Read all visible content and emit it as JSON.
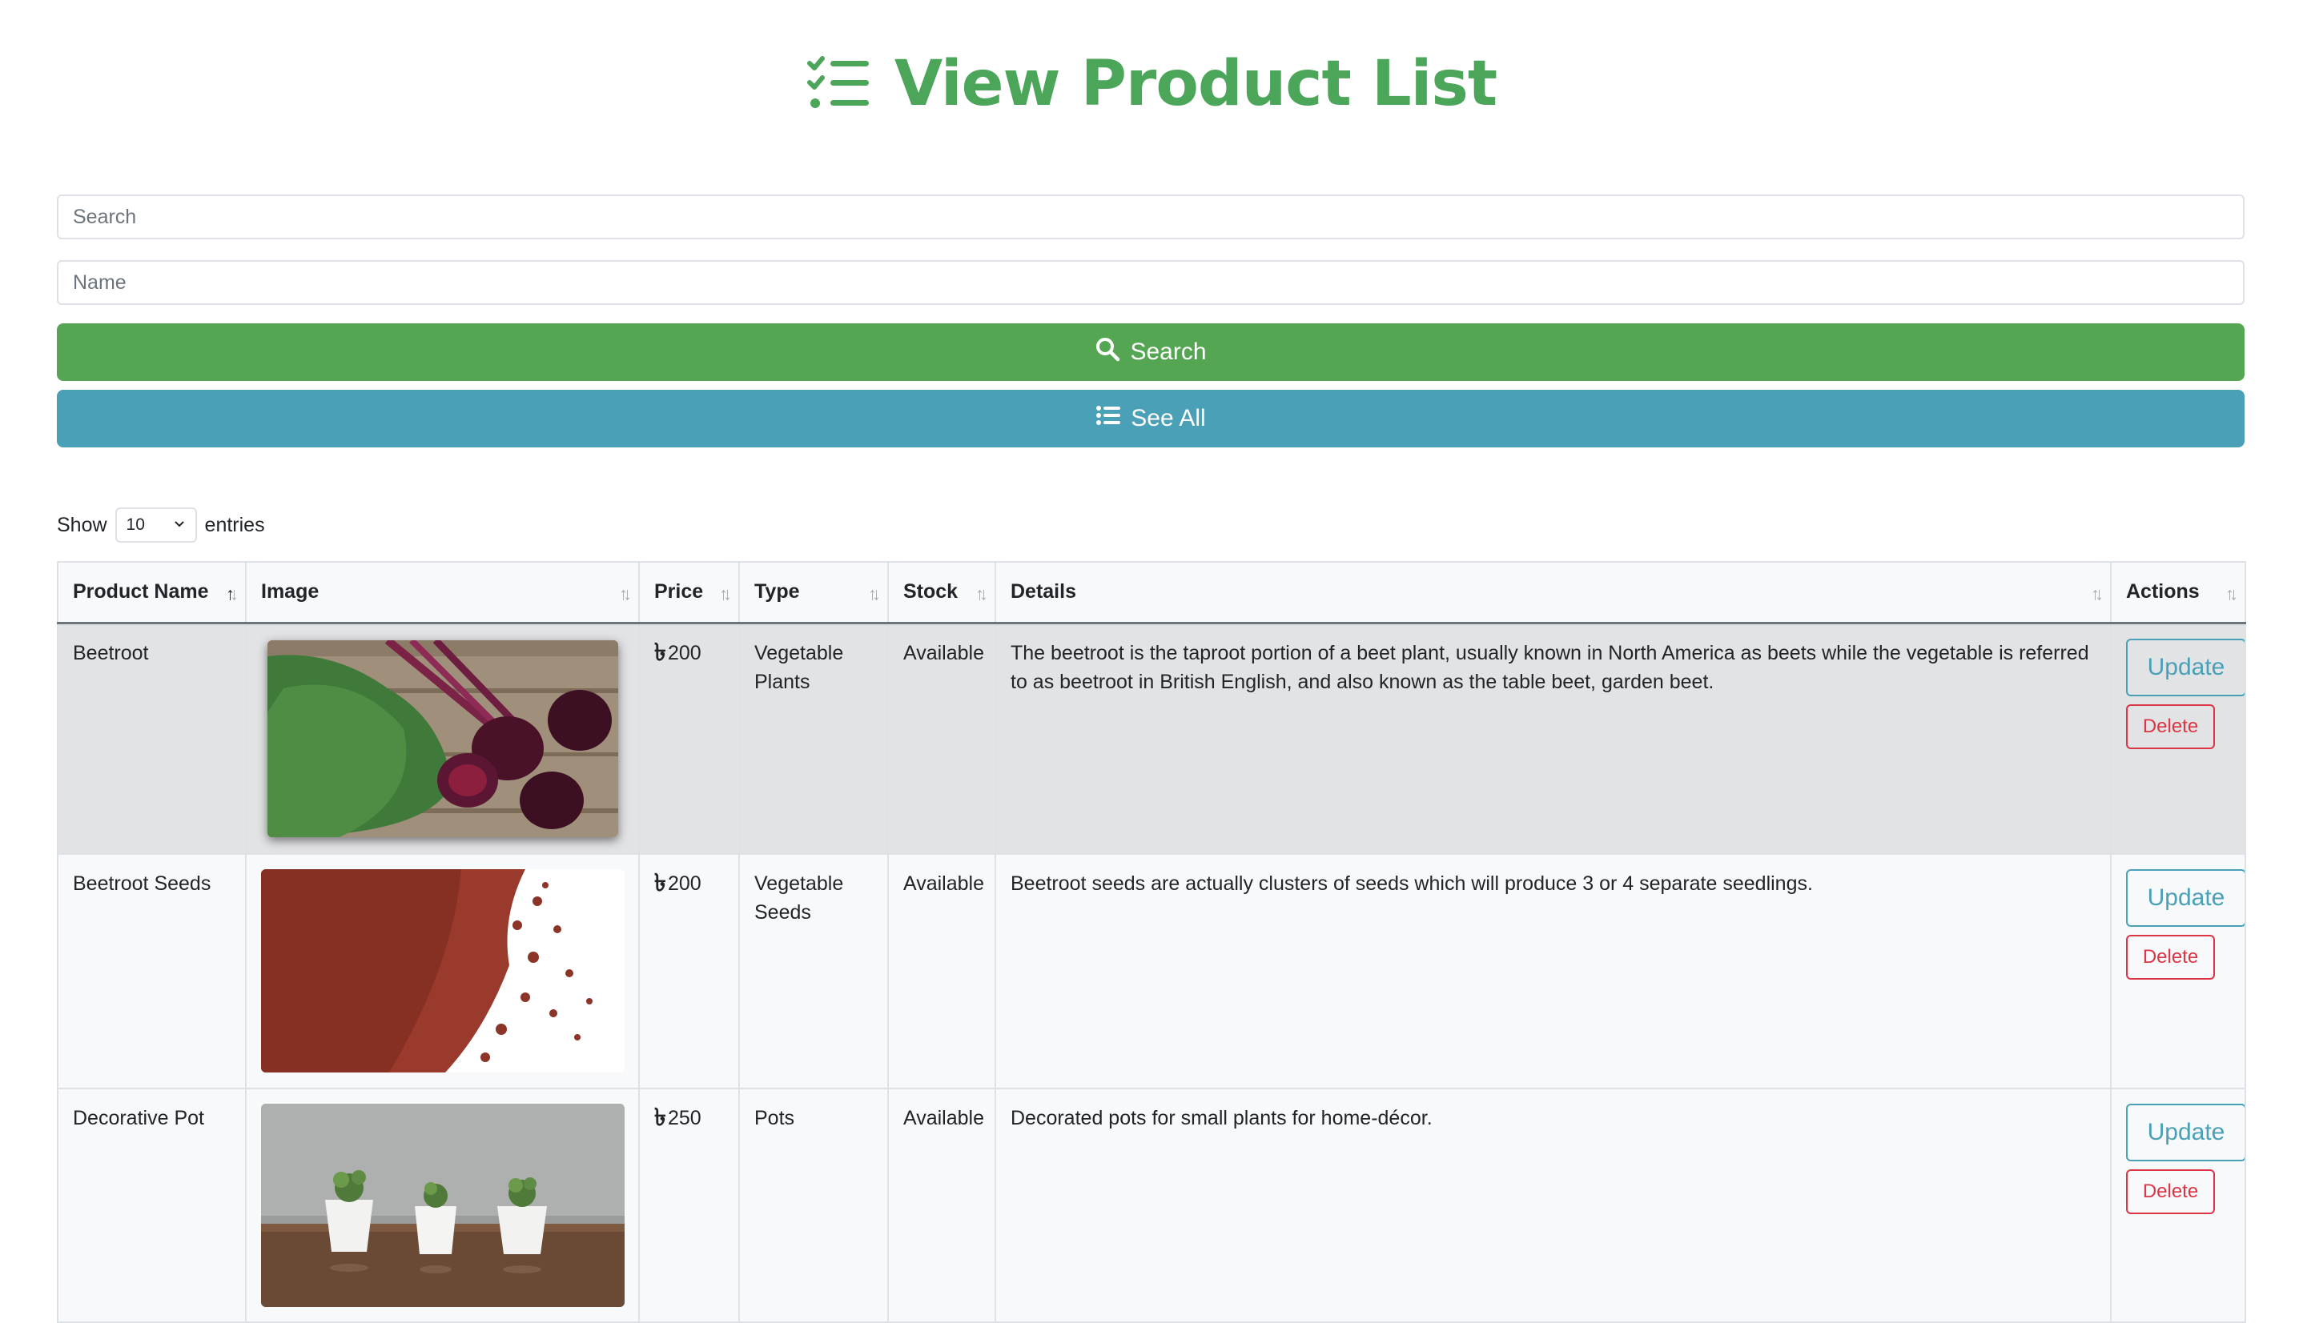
{
  "page": {
    "title": "View Product List",
    "title_icon": "list-check-icon",
    "accent_color": "#4ca65a"
  },
  "search_form": {
    "search_placeholder": "Search",
    "name_placeholder": "Name",
    "search_button_label": "Search",
    "search_button_icon": "magnifier-icon",
    "search_button_color": "#55a653",
    "see_all_button_label": "See All",
    "see_all_button_icon": "list-icon",
    "see_all_button_color": "#4aa0b6"
  },
  "table_length": {
    "show_label": "Show",
    "selected_value": "10",
    "entries_label": "entries"
  },
  "table": {
    "columns": [
      "Product Name",
      "Image",
      "Price",
      "Type",
      "Stock",
      "Details",
      "Actions"
    ],
    "currency_symbol": "৳",
    "rows": [
      {
        "name": "Beetroot",
        "image": "beetroot-photo",
        "price": "200",
        "type": "Vegetable Plants",
        "stock": "Available",
        "details": "The beetroot is the taproot portion of a beet plant, usually known in North America as beets while the vegetable is referred to as beetroot in British English, and also known as the table beet, garden beet.",
        "update_label": "Update",
        "delete_label": "Delete"
      },
      {
        "name": "Beetroot Seeds",
        "image": "beetroot-seeds-photo",
        "price": "200",
        "type": "Vegetable Seeds",
        "stock": "Available",
        "details": "Beetroot seeds are actually clusters of seeds which will produce 3 or 4 separate seedlings.",
        "update_label": "Update",
        "delete_label": "Delete"
      },
      {
        "name": "Decorative Pot",
        "image": "decorative-pots-photo",
        "price": "250",
        "type": "Pots",
        "stock": "Available",
        "details": "Decorated pots for small plants for home-décor.",
        "update_label": "Update",
        "delete_label": "Delete"
      }
    ]
  }
}
